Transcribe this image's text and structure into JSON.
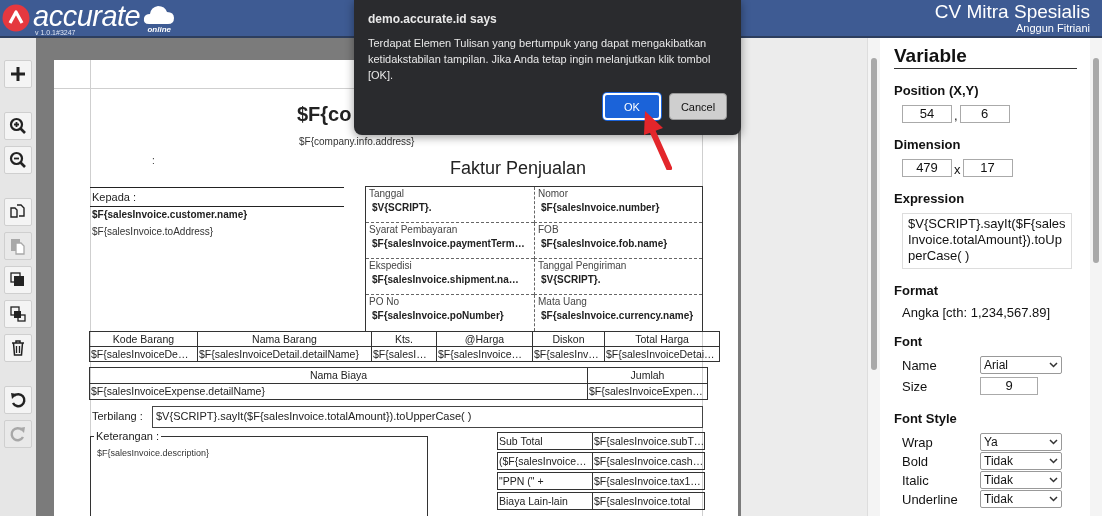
{
  "header": {
    "logo_text": "accurate",
    "logo_sub": "online",
    "version": "v 1.0.1#3247",
    "company": "CV Mitra Spesialis",
    "user": "Anggun Fitriani"
  },
  "toolbar": [
    {
      "kind": "add",
      "disabled": false
    },
    {
      "kind": "zoom_in",
      "disabled": false
    },
    {
      "kind": "zoom_out",
      "disabled": false
    },
    {
      "kind": "copy",
      "disabled": false
    },
    {
      "kind": "paste",
      "disabled": true
    },
    {
      "kind": "bring_front",
      "disabled": false
    },
    {
      "kind": "send_back",
      "disabled": false
    },
    {
      "kind": "delete",
      "disabled": false
    },
    {
      "kind": "undo",
      "disabled": false
    },
    {
      "kind": "redo",
      "disabled": true
    }
  ],
  "report": {
    "title": "$F{co",
    "address": "$F{company.info.address}",
    "colon": ":",
    "heading": "Faktur Penjualan",
    "recipient_label": "Kepada :",
    "customer_name": "$F{salesInvoice.customer.name}",
    "customer_address": "$F{salesInvoice.toAddress}",
    "info_grid": [
      {
        "label": "Tanggal",
        "value": "$V{SCRIPT}."
      },
      {
        "label": "Nomor",
        "value": "$F{salesInvoice.number}"
      },
      {
        "label": "Syarat Pembayaran",
        "value": "$F{salesInvoice.paymentTerm…"
      },
      {
        "label": "FOB",
        "value": "$F{salesInvoice.fob.name}"
      },
      {
        "label": "Ekspedisi",
        "value": "$F{salesInvoice.shipment.na…"
      },
      {
        "label": "Tanggal Pengiriman",
        "value": "$V{SCRIPT}."
      },
      {
        "label": "PO No",
        "value": "$F{salesInvoice.poNumber}"
      },
      {
        "label": "Mata Uang",
        "value": "$F{salesInvoice.currency.name}"
      }
    ],
    "items": {
      "columns": [
        "Kode Barang",
        "Nama Barang",
        "Kts.",
        "@Harga",
        "Diskon",
        "Total Harga"
      ],
      "row": [
        "$F{salesInvoiceDe…",
        "$F{salesInvoiceDetail.detailName}",
        "$F{salesI…",
        "$F{salesInvoice…",
        "$F{salesInv…",
        "$F{salesInvoiceDetai…"
      ]
    },
    "expenses": {
      "columns": [
        "Nama Biaya",
        "Jumlah"
      ],
      "row": [
        "$F{salesInvoiceExpense.detailName}",
        "$F{salesInvoiceExpen…"
      ]
    },
    "terbilang": {
      "label": "Terbilang :",
      "value": "$V{SCRIPT}.sayIt($F{salesInvoice.totalAmount}).toUpperCase( )"
    },
    "notes": {
      "legend": "Keterangan :",
      "value": "$F{salesInvoice.description}"
    },
    "summary": [
      [
        "Sub Total",
        "$F{salesInvoice.subT…"
      ],
      [
        "($F{salesInvoice…",
        "$F{salesInvoice.cash…"
      ],
      [
        "\"PPN (\" +",
        "$F{salesInvoice.tax1…"
      ],
      [
        "Biaya Lain-lain",
        "$F{salesInvoice.total"
      ]
    ]
  },
  "properties": {
    "title": "Variable",
    "sections": [
      {
        "kind": "pair",
        "title": "Position (X,Y)",
        "values": [
          "54",
          "6"
        ],
        "separator": ","
      },
      {
        "kind": "pair",
        "title": "Dimension",
        "values": [
          "479",
          "17"
        ],
        "separator": "x"
      },
      {
        "kind": "textarea",
        "title": "Expression",
        "value": "$V{SCRIPT}.sayIt($F{salesInvoice.totalAmount}).toUpperCase( )"
      },
      {
        "kind": "text",
        "title": "Format",
        "value": "Angka [cth: 1,234,567.89]"
      },
      {
        "kind": "fields",
        "title": "Font",
        "rows": [
          {
            "label": "Name",
            "kind": "select",
            "value": "Arial"
          },
          {
            "label": "Size",
            "kind": "input",
            "value": "9"
          }
        ]
      },
      {
        "kind": "fields",
        "title": "Font Style",
        "rows": [
          {
            "label": "Wrap",
            "kind": "select",
            "value": "Ya"
          },
          {
            "label": "Bold",
            "kind": "select",
            "value": "Tidak"
          },
          {
            "label": "Italic",
            "kind": "select",
            "value": "Tidak"
          },
          {
            "label": "Underline",
            "kind": "select",
            "value": "Tidak"
          }
        ]
      }
    ]
  },
  "dialog": {
    "title": "demo.accurate.id says",
    "message": "Terdapat Elemen Tulisan yang bertumpuk yang dapat mengakibatkan ketidakstabilan tampilan. Jika Anda tetap ingin melanjutkan klik tombol [OK].",
    "buttons": [
      {
        "label": "OK",
        "kind": "primary"
      },
      {
        "label": "Cancel",
        "kind": "secondary"
      }
    ]
  }
}
